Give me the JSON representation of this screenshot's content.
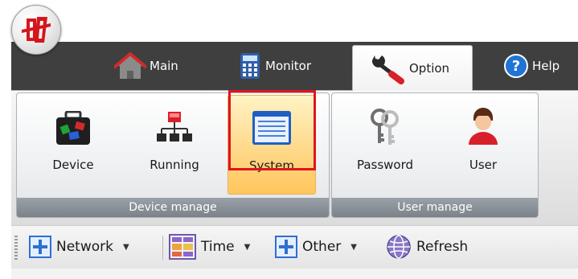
{
  "tabs": [
    {
      "label": "Main",
      "icon": "home-icon"
    },
    {
      "label": "Monitor",
      "icon": "calculator-icon"
    },
    {
      "label": "Option",
      "icon": "wrench-icon",
      "active": true
    },
    {
      "label": "Help",
      "icon": "help-icon"
    }
  ],
  "ribbon": {
    "device_group": {
      "caption": "Device manage",
      "buttons": [
        {
          "label": "Device",
          "icon": "device-briefcase-icon"
        },
        {
          "label": "Running",
          "icon": "network-tree-icon"
        },
        {
          "label": "System",
          "icon": "system-window-icon",
          "selected": true
        }
      ]
    },
    "user_group": {
      "caption": "User manage",
      "buttons": [
        {
          "label": "Password",
          "icon": "keys-icon"
        },
        {
          "label": "User",
          "icon": "user-icon"
        }
      ]
    }
  },
  "toolbar": {
    "items": [
      {
        "label": "Network",
        "icon": "plus-icon",
        "dropdown": true
      },
      {
        "label": "Time",
        "icon": "calendar-icon",
        "dropdown": true
      },
      {
        "label": "Other",
        "icon": "plus-icon",
        "dropdown": true
      },
      {
        "label": "Refresh",
        "icon": "globe-icon",
        "dropdown": false
      }
    ]
  },
  "colors": {
    "tabstrip": "#3f3f3f",
    "highlight_box": "#e0141e",
    "selected_button": "#ffd98a",
    "group_caption": "#8a9198"
  }
}
